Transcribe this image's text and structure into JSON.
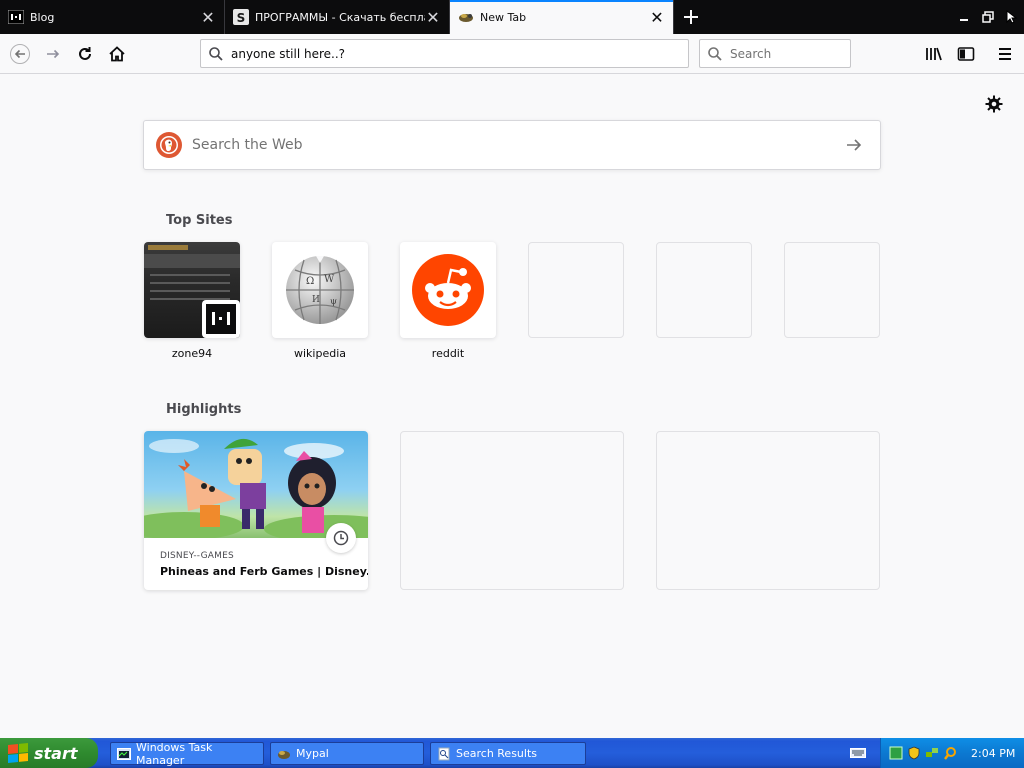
{
  "browser": {
    "tabs": [
      {
        "title": "Blog",
        "active": false
      },
      {
        "title": "ПРОГРАММЫ - Скачать бесплатно",
        "active": false
      },
      {
        "title": "New Tab",
        "active": true
      }
    ],
    "new_tab_icon": "plus-icon",
    "window_controls": [
      "minimize-icon",
      "restore-icon",
      "close-icon"
    ]
  },
  "navbar": {
    "url_value": "anyone still here..?",
    "search_placeholder": "Search",
    "icons": [
      "back-arrow-icon",
      "forward-arrow-icon",
      "reload-icon",
      "home-icon",
      "library-icon",
      "sidebar-icon",
      "menu-icon"
    ]
  },
  "newtab": {
    "web_search_placeholder": "Search the Web",
    "top_sites_title": "Top Sites",
    "top_sites": [
      {
        "label": "zone94"
      },
      {
        "label": "wikipedia"
      },
      {
        "label": "reddit"
      },
      {
        "label": ""
      },
      {
        "label": ""
      },
      {
        "label": ""
      }
    ],
    "highlights_title": "Highlights",
    "highlights": [
      {
        "source": "DISNEY--GAMES",
        "title": "Phineas and Ferb Games | Disney..."
      }
    ]
  },
  "taskbar": {
    "start_label": "start",
    "tasks": [
      {
        "label": "Windows Task Manager"
      },
      {
        "label": "Mypal"
      },
      {
        "label": "Search Results"
      }
    ],
    "clock": "2:04 PM"
  },
  "colors": {
    "tab_strip": "#0c0c0d",
    "accent": "#0a84ff",
    "reddit": "#ff4500",
    "duckduckgo": "#de5833",
    "xp_taskbar": "#245edb",
    "xp_start": "#2f8b2f"
  }
}
